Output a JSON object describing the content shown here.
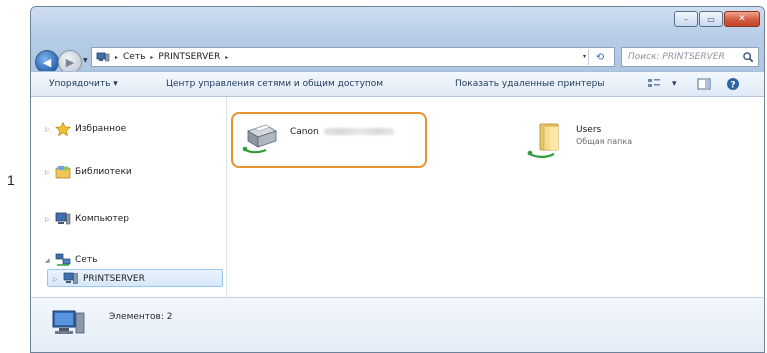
{
  "step_number": "1",
  "window": {
    "controls": {
      "minimize": "–",
      "maximize": "▭",
      "close": "✕"
    }
  },
  "address_bar": {
    "crumbs": [
      "Сеть",
      "PRINTSERVER"
    ],
    "separator": "▸",
    "dropdown": "▾",
    "refresh": "⟲"
  },
  "search": {
    "placeholder": "Поиск: PRINTSERVER"
  },
  "toolbar": {
    "organize": "Упорядочить ▾",
    "network_center": "Центр управления сетями и общим доступом",
    "remote_printers": "Показать удаленные принтеры",
    "views_dropdown": "▾",
    "help": "?"
  },
  "nav_pane": {
    "items": [
      {
        "label": "Избранное",
        "icon": "star-icon"
      },
      {
        "label": "Библиотеки",
        "icon": "library-icon"
      },
      {
        "label": "Компьютер",
        "icon": "computer-icon"
      },
      {
        "label": "Сеть",
        "icon": "network-icon"
      },
      {
        "label": "PRINTSERVER",
        "icon": "server-icon"
      }
    ],
    "expand_glyph": "▷",
    "collapse_glyph": "◢"
  },
  "content": {
    "items": [
      {
        "name": "Canon",
        "subtitle": "",
        "icon": "shared-printer-icon"
      },
      {
        "name": "Users",
        "subtitle": "Общая папка",
        "icon": "shared-folder-icon"
      }
    ]
  },
  "details": {
    "count_text": "Элементов: 2"
  },
  "colors": {
    "highlight": "#e8922b",
    "titlebar": "#b7cde6",
    "close_button": "#d35a3e"
  }
}
